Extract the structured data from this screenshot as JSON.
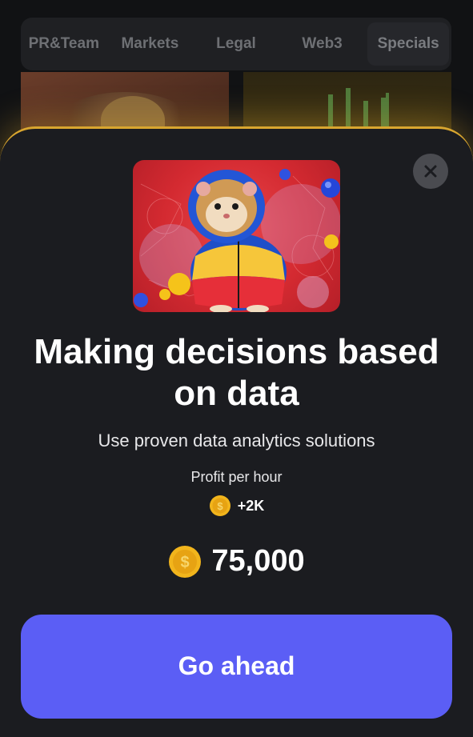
{
  "tabs": [
    {
      "label": "PR&Team"
    },
    {
      "label": "Markets"
    },
    {
      "label": "Legal"
    },
    {
      "label": "Web3"
    },
    {
      "label": "Specials"
    }
  ],
  "active_tab": "Specials",
  "modal": {
    "title": "Making decisions based on data",
    "description": "Use proven data analytics solutions",
    "profit_label": "Profit per hour",
    "profit_value": "+2K",
    "price": "75,000",
    "button_label": "Go ahead"
  },
  "icons": {
    "close": "close-icon",
    "coin": "coin-icon"
  },
  "colors": {
    "accent_button": "#5b5ef5",
    "sheet_border": "#d9a62f",
    "sheet_bg": "#1b1c20",
    "coin_gold": "#f2b51c"
  }
}
